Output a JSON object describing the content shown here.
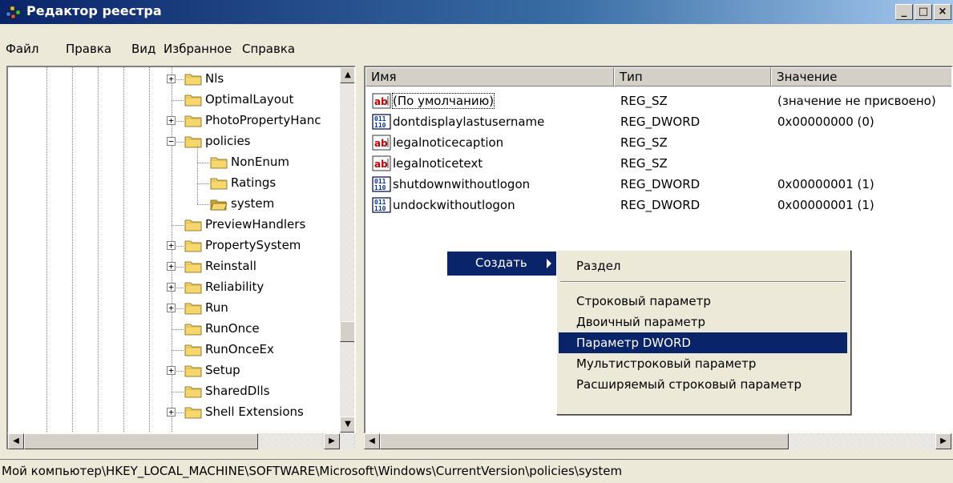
{
  "window": {
    "title": "Редактор реестра"
  },
  "menu": [
    "Файл",
    "Правка",
    "Вид",
    "Избранное",
    "Справка"
  ],
  "tree": {
    "items": [
      {
        "label": "Nls",
        "expander": "+"
      },
      {
        "label": "OptimalLayout",
        "expander": ""
      },
      {
        "label": "PhotoPropertyHanc",
        "expander": "+"
      },
      {
        "label": "policies",
        "expander": "−"
      },
      {
        "label": "NonEnum",
        "expander": ""
      },
      {
        "label": "Ratings",
        "expander": ""
      },
      {
        "label": "system",
        "expander": "",
        "selected": true
      },
      {
        "label": "PreviewHandlers",
        "expander": ""
      },
      {
        "label": "PropertySystem",
        "expander": "+"
      },
      {
        "label": "Reinstall",
        "expander": "+"
      },
      {
        "label": "Reliability",
        "expander": "+"
      },
      {
        "label": "Run",
        "expander": "+"
      },
      {
        "label": "RunOnce",
        "expander": ""
      },
      {
        "label": "RunOnceEx",
        "expander": ""
      },
      {
        "label": "Setup",
        "expander": "+"
      },
      {
        "label": "SharedDlls",
        "expander": ""
      },
      {
        "label": "Shell Extensions",
        "expander": "+"
      }
    ]
  },
  "list": {
    "columns": [
      "Имя",
      "Тип",
      "Значение"
    ],
    "rows": [
      {
        "icon": "string-value-icon",
        "name": "(По умолчанию)",
        "type": "REG_SZ",
        "value": "(значение не присвоено)"
      },
      {
        "icon": "dword-value-icon",
        "name": "dontdisplaylastusername",
        "type": "REG_DWORD",
        "value": "0x00000000 (0)"
      },
      {
        "icon": "string-value-icon",
        "name": "legalnoticecaption",
        "type": "REG_SZ",
        "value": ""
      },
      {
        "icon": "string-value-icon",
        "name": "legalnoticetext",
        "type": "REG_SZ",
        "value": ""
      },
      {
        "icon": "dword-value-icon",
        "name": "shutdownwithoutlogon",
        "type": "REG_DWORD",
        "value": "0x00000001 (1)"
      },
      {
        "icon": "dword-value-icon",
        "name": "undockwithoutlogon",
        "type": "REG_DWORD",
        "value": "0x00000001 (1)"
      }
    ]
  },
  "context_menu": {
    "create_label": "Создать"
  },
  "submenu": {
    "items": [
      "Раздел",
      "Строковый параметр",
      "Двоичный параметр",
      "Параметр DWORD",
      "Мультистроковый параметр",
      "Расширяемый строковый параметр"
    ],
    "highlighted_index": 3
  },
  "statusbar": {
    "path": "Мой компьютер\\HKEY_LOCAL_MACHINE\\SOFTWARE\\Microsoft\\Windows\\CurrentVersion\\policies\\system"
  },
  "colors": {
    "titlebar": "#0a246a",
    "highlight": "#0a246a",
    "folder": "#f5d76e"
  }
}
